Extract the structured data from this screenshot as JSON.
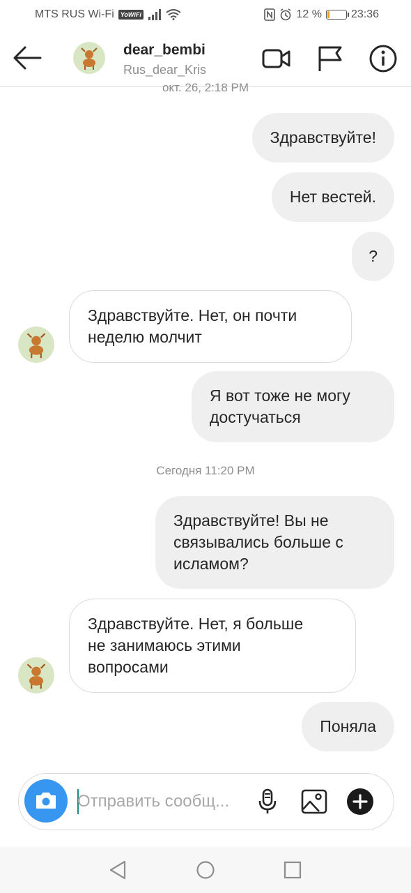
{
  "status_bar": {
    "carrier": "MTS RUS Wi-Fi",
    "wifi_badge": "YoWiFi",
    "battery_percent": "12 %",
    "battery_level": 0.12,
    "time": "23:36"
  },
  "header": {
    "username": "dear_bembi",
    "subtitle": "Rus_dear_Kris",
    "icons": [
      "back-arrow-icon",
      "video-call-icon",
      "flag-icon",
      "info-icon"
    ]
  },
  "messages": {
    "timestamp_1": "окт. 26, 2:18 PM",
    "m1": "Здравствуйте!",
    "m2": "Нет вестей.",
    "m3": "?",
    "m4_l1": "Здравствуйте. Нет, он почти",
    "m4_l2": "неделю молчит",
    "m5_l1": "Я вот тоже не могу",
    "m5_l2": "достучаться",
    "timestamp_2": "Сегодня 11:20 PM",
    "m6_l1": "Здравствуйте! Вы не",
    "m6_l2": "связывались больше с",
    "m6_l3": "исламом?",
    "m7_l1": "Здравствуйте. Нет, я больше",
    "m7_l2": "не занимаюсь этими",
    "m7_l3": "вопросами",
    "m8": "Поняла"
  },
  "composer": {
    "placeholder": "Отправить сообщ...",
    "icons": [
      "camera-icon",
      "microphone-icon",
      "gallery-icon",
      "plus-icon"
    ]
  },
  "colors": {
    "accent": "#3797f0",
    "sent_bubble": "#efefef",
    "border": "#dbdbdb",
    "muted_text": "#8e8e8e"
  }
}
